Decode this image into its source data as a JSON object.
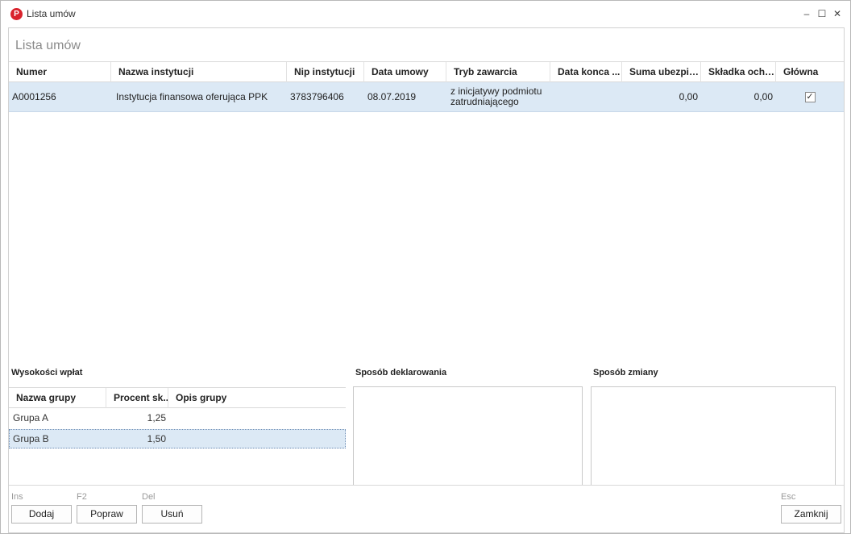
{
  "window": {
    "title": "Lista umów",
    "logo_letter": "P",
    "controls": {
      "minimize": "–",
      "maximize": "☐",
      "close": "✕"
    }
  },
  "header": {
    "title": "Lista umów"
  },
  "contracts_grid": {
    "columns": [
      "Numer",
      "Nazwa instytucji",
      "Nip instytucji",
      "Data umowy",
      "Tryb zawarcia",
      "Data konca ...",
      "Suma ubezpie...",
      "Składka ochr...",
      "Główna"
    ],
    "rows": [
      {
        "numer": "A0001256",
        "nazwa": "Instytucja finansowa oferująca PPK",
        "nip": "3783796406",
        "data_umowy": "08.07.2019",
        "tryb_line1": "z inicjatywy podmiotu",
        "tryb_line2": "zatrudniającego",
        "data_konca": "",
        "suma": "0,00",
        "skladka": "0,00",
        "glowna_checked": true,
        "check_glyph": "✓"
      }
    ]
  },
  "payments": {
    "label": "Wysokości wpłat",
    "columns": [
      "Nazwa grupy",
      "Procent sk...",
      "Opis grupy"
    ],
    "rows": [
      {
        "nazwa": "Grupa A",
        "procent": "1,25",
        "opis": ""
      },
      {
        "nazwa": "Grupa B",
        "procent": "1,50",
        "opis": ""
      }
    ]
  },
  "declaration": {
    "label": "Sposób deklarowania"
  },
  "change": {
    "label": "Sposób zmiany"
  },
  "footer": {
    "add": {
      "shortcut": "Ins",
      "label": "Dodaj"
    },
    "edit": {
      "shortcut": "F2",
      "label": "Popraw"
    },
    "delete": {
      "shortcut": "Del",
      "label": "Usuń"
    },
    "close": {
      "shortcut": "Esc",
      "label": "Zamknij"
    }
  },
  "colors": {
    "selection": "#dce9f5",
    "logo": "#d9232d",
    "header_text": "#8a8a8a"
  }
}
